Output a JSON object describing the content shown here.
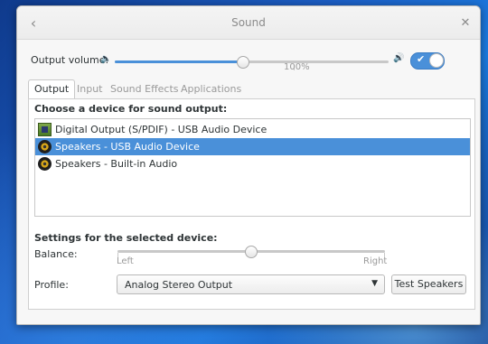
{
  "window": {
    "title": "Sound"
  },
  "output_volume": {
    "label": "Output volume:",
    "level_percent": 47,
    "mark_label": "100%",
    "low_icon": "speaker-low-icon",
    "high_icon": "speaker-high-icon",
    "mute_switch_on": true,
    "switch_check": "✔"
  },
  "tabs": [
    {
      "label": "Output",
      "active": true
    },
    {
      "label": "Input",
      "active": false
    },
    {
      "label": "Sound Effects",
      "active": false
    },
    {
      "label": "Applications",
      "active": false
    }
  ],
  "output": {
    "device_heading": "Choose a device for sound output:",
    "devices": [
      {
        "label": "Digital Output (S/PDIF) - USB Audio Device",
        "icon": "spdif-icon",
        "selected": false
      },
      {
        "label": "Speakers - USB Audio Device",
        "icon": "speaker-icon",
        "selected": true
      },
      {
        "label": "Speakers - Built-in Audio",
        "icon": "speaker-icon",
        "selected": false
      }
    ],
    "settings_heading": "Settings for the selected device:",
    "balance": {
      "label": "Balance:",
      "left_label": "Left",
      "right_label": "Right",
      "value": 0.5
    },
    "profile": {
      "label": "Profile:",
      "selected": "Analog Stereo Output"
    },
    "test_button": "Test Speakers"
  },
  "colors": {
    "accent": "#4a90d9",
    "window_bg": "#f7f7f7"
  }
}
